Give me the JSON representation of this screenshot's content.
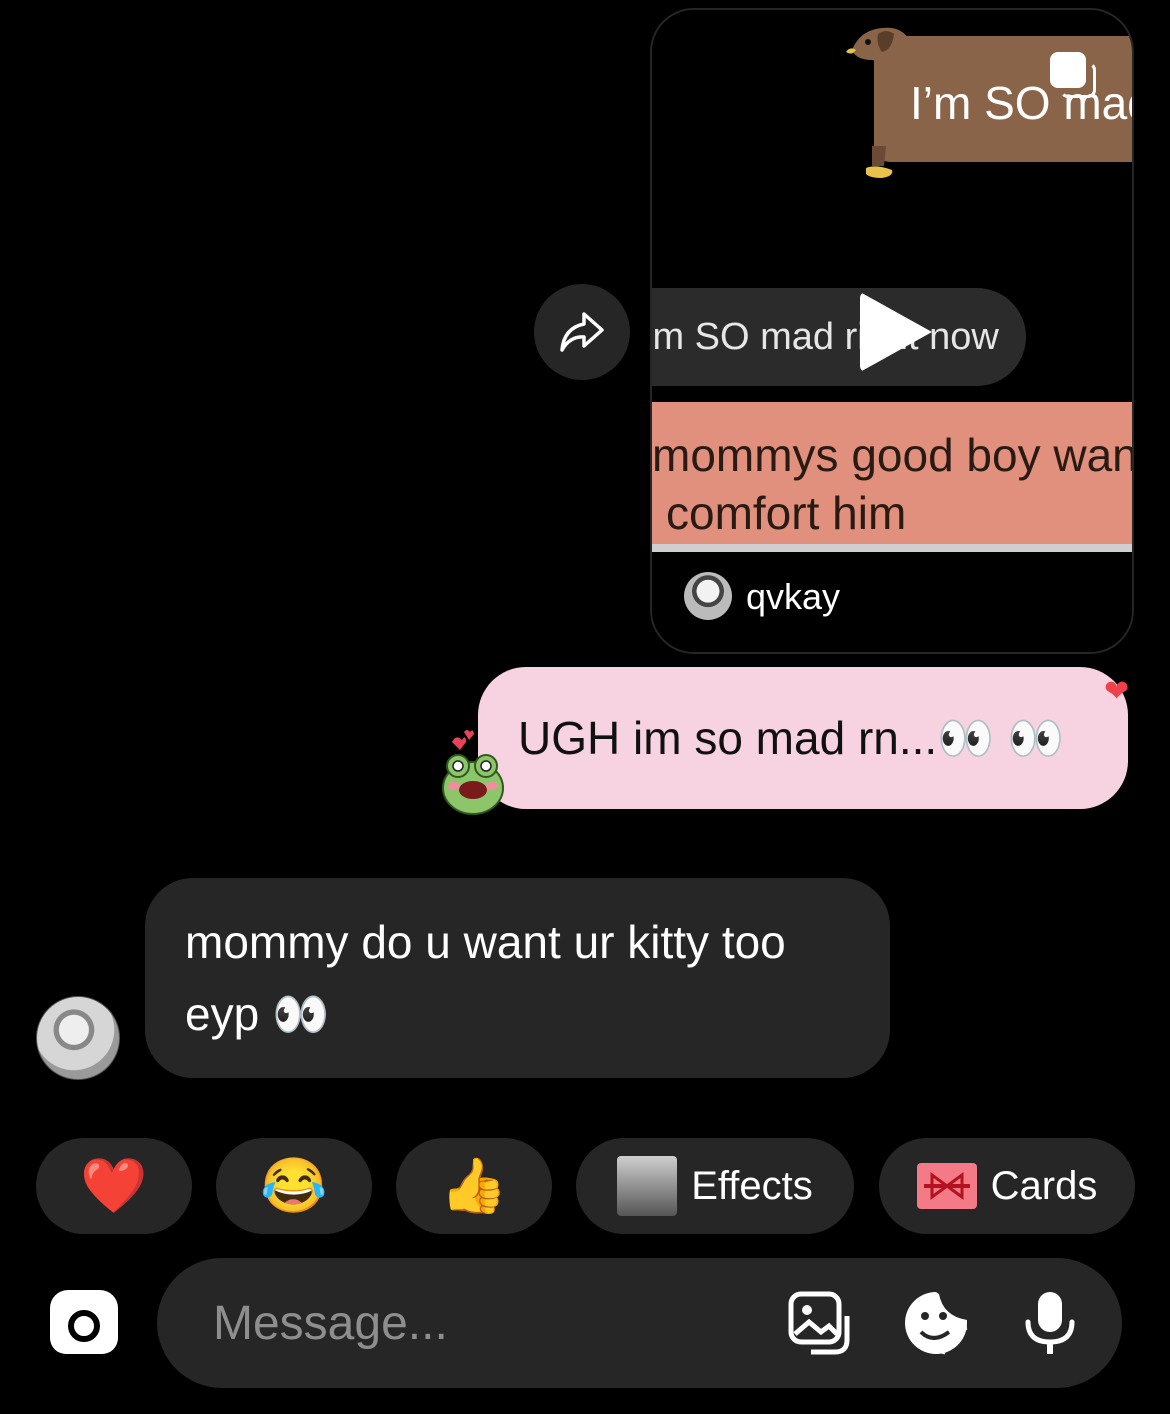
{
  "shared_reel": {
    "top_banner_text": "I’m SO mad",
    "dark_pill_text": "’m SO mad right now",
    "salmon_line_1": "mommys good boy wants",
    "salmon_line_2": "comfort him",
    "author": "qvkay",
    "play_icon": "play-icon",
    "reels_icon": "reels-icon"
  },
  "share_button": {
    "icon": "share-icon"
  },
  "messages": [
    {
      "direction": "outgoing",
      "text": "UGH im so mad rn...👀 👀",
      "reaction": "❤",
      "sticker": "frog-sticker"
    },
    {
      "direction": "incoming",
      "line1": "mommy do u want ur kitty too",
      "line2": "eyp 👀"
    }
  ],
  "quick_reactions": [
    {
      "emoji": "❤️"
    },
    {
      "emoji": "😂"
    },
    {
      "emoji": "👍"
    },
    {
      "label": "Effects"
    },
    {
      "label": "Cards"
    }
  ],
  "composer": {
    "placeholder": "Message...",
    "camera_icon": "camera-icon",
    "gallery_icon": "gallery-icon",
    "sticker_icon": "sticker-icon",
    "mic_icon": "microphone-icon"
  },
  "colors": {
    "background": "#000000",
    "incoming_bubble": "#262626",
    "outgoing_bubble": "#f7d3e2",
    "salmon_banner": "#e0907c",
    "brown_banner": "#8a6448"
  }
}
